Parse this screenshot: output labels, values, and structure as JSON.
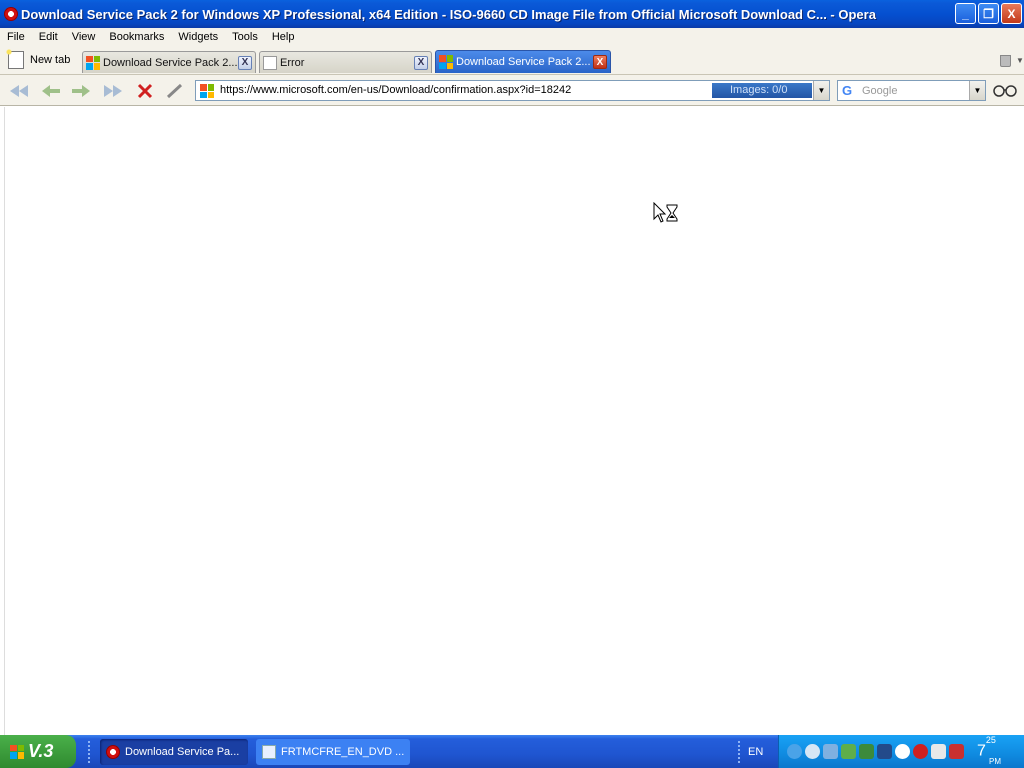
{
  "window": {
    "title": "Download Service Pack 2 for Windows XP Professional, x64 Edition - ISO-9660 CD Image File from Official Microsoft Download C... - Opera",
    "minimize": "_",
    "restore": "❐",
    "close": "X"
  },
  "menu": [
    "File",
    "Edit",
    "View",
    "Bookmarks",
    "Widgets",
    "Tools",
    "Help"
  ],
  "tabs": {
    "new_tab_label": "New tab",
    "items": [
      {
        "label": "Download Service Pack 2...",
        "close": "X"
      },
      {
        "label": "Error",
        "close": "X"
      },
      {
        "label": "Download Service Pack 2...",
        "close": "X"
      }
    ]
  },
  "navigation": {
    "rewind_icon": "rewind-icon",
    "back_icon": "back-arrow-icon",
    "forward_icon": "forward-arrow-icon",
    "fastforward_icon": "fast-forward-icon",
    "stop_icon": "stop-icon",
    "edit_icon": "pencil-icon"
  },
  "address": {
    "url": "https://www.microsoft.com/en-us/Download/confirmation.aspx?id=18242",
    "images": "Images:   0/0"
  },
  "search": {
    "engine_glyph": "G",
    "placeholder": "Google"
  },
  "taskbar": {
    "start_label": "V.3",
    "tasks": [
      {
        "label": "Download Service Pa..."
      },
      {
        "label": "FRTMCFRE_EN_DVD ..."
      }
    ],
    "language": "EN",
    "clock_hour": "7",
    "clock_minute": "25",
    "clock_ampm": "PM"
  },
  "colors": {
    "titlebar": "#0550d0",
    "active_tab": "#2a64c8",
    "taskbar": "#245edb",
    "start": "#2f8a2f"
  }
}
